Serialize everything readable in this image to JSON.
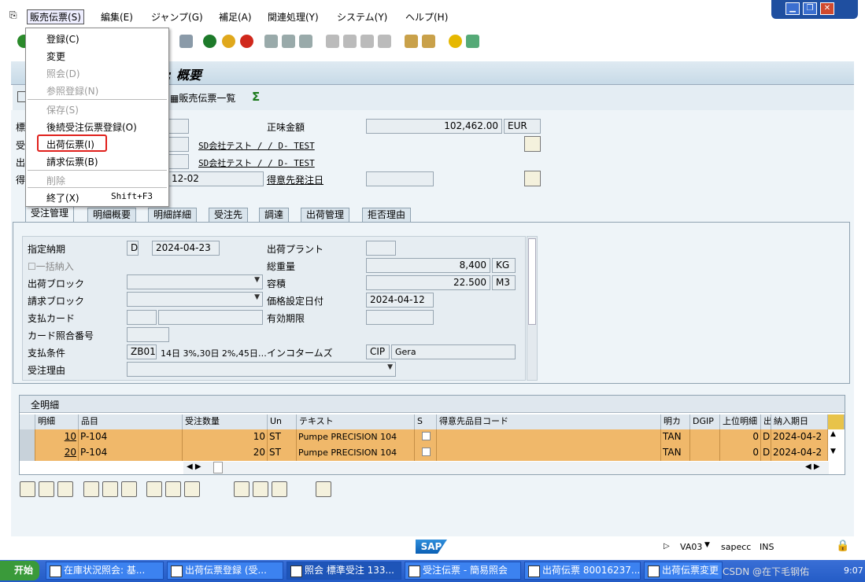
{
  "menubar": {
    "items": [
      "販売伝票(S)",
      "編集(E)",
      "ジャンプ(G)",
      "補足(A)",
      "関連処理(Y)",
      "システム(Y)",
      "ヘルプ(H)"
    ]
  },
  "title": {
    "text": "受注伝票 133... : 概要",
    "visible_part": ": 概要"
  },
  "app_toolbar": {
    "list_label": "販売伝票一覧"
  },
  "header": {
    "net_value_label": "正味金額",
    "net_value": "102,462.00",
    "currency": "EUR",
    "soldto_name": "SD会社テスト / / D- TEST",
    "shipto_name": "SD会社テスト / / D- TEST",
    "date_partial": "12-02",
    "cust_ref_date_label": "得意先発注日"
  },
  "tabs": [
    "受注管理",
    "明細概要",
    "明細詳細",
    "受注先",
    "調達",
    "出荷管理",
    "拒否理由"
  ],
  "form": {
    "req_deliv_label": "指定納期",
    "req_deliv_type": "D",
    "req_deliv_date": "2024-04-23",
    "plant_label": "出荷プラント",
    "complete_label": "一括納入",
    "weight_label": "総重量",
    "weight": "8,400",
    "weight_unit": "KG",
    "block_label": "出荷ブロック",
    "volume_label": "容積",
    "volume": "22.500",
    "volume_unit": "M3",
    "billing_block_label": "請求ブロック",
    "pricing_date_label": "価格設定日付",
    "pricing_date": "2024-04-12",
    "card_label": "支払カード",
    "expiry_label": "有効期限",
    "card_ref_label": "カード照合番号",
    "terms_label": "支払条件",
    "terms": "ZB01",
    "terms_text": "14日 3%,30日 2%,45日…",
    "incoterms_label": "インコタームズ",
    "incoterms": "CIP",
    "incoterms2": "Gera",
    "order_reason_label": "受注理由"
  },
  "grid": {
    "title": "全明細",
    "columns": [
      "明細",
      "品目",
      "受注数量",
      "Un",
      "テキスト",
      "S",
      "得意先品目コード",
      "明カ",
      "DGIP",
      "上位明細",
      "出",
      "納入期日"
    ],
    "rows": [
      {
        "item": "10",
        "material": "P-104",
        "qty": "10",
        "unit": "ST",
        "text": "Pumpe PRECISION 104",
        "cat": "TAN",
        "hl": "0",
        "d": "D",
        "date": "2024-04-2"
      },
      {
        "item": "20",
        "material": "P-104",
        "qty": "20",
        "unit": "ST",
        "text": "Pumpe PRECISION 104",
        "cat": "TAN",
        "hl": "0",
        "d": "D",
        "date": "2024-04-2"
      }
    ]
  },
  "menu": {
    "items": [
      {
        "label": "登録(C)",
        "enabled": true
      },
      {
        "label": "変更",
        "enabled": true
      },
      {
        "label": "照会(D)",
        "enabled": false
      },
      {
        "label": "参照登録(N)",
        "enabled": false
      },
      {
        "label": "保存(S)",
        "enabled": false
      },
      {
        "label": "後続受注伝票登録(O)",
        "enabled": true
      },
      {
        "label": "出荷伝票(I)",
        "enabled": true,
        "highlighted": true
      },
      {
        "label": "請求伝票(B)",
        "enabled": true
      },
      {
        "label": "削除",
        "enabled": false
      },
      {
        "label": "終了(X)",
        "enabled": true,
        "shortcut": "Shift+F3"
      }
    ]
  },
  "status": {
    "tcode": "VA03",
    "server": "sapecc",
    "mode": "INS",
    "logo": "SAP"
  },
  "taskbar": {
    "start": "开始",
    "tasks": [
      "在庫状況照会: 基...",
      "出荷伝票登録 (受...",
      "照会 標準受注 133...",
      "受注伝票 - 簡易照会",
      "出荷伝票 80016237...",
      "出荷伝票変更"
    ],
    "watermark": "CSDN @在下毛钢佑",
    "time": "9:07"
  },
  "colors": {
    "accent_highlight": "#e0201c",
    "row_bg": "#f0b86a",
    "title_bg": "#c7dae7"
  }
}
